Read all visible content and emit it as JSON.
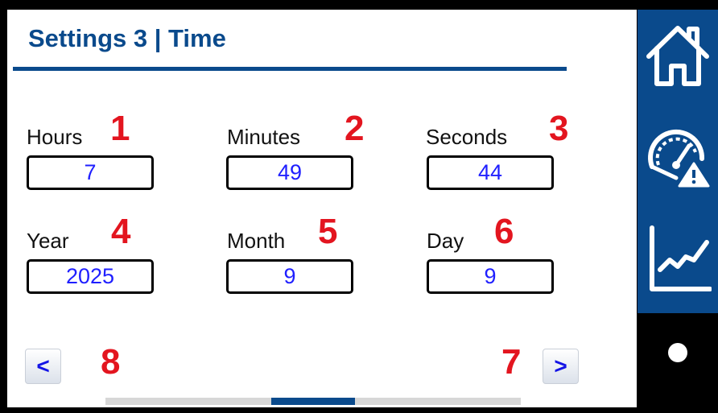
{
  "header": {
    "title": "Settings 3 | Time"
  },
  "fields": [
    {
      "label": "Hours",
      "value": "7",
      "callout": "1"
    },
    {
      "label": "Minutes",
      "value": "49",
      "callout": "2"
    },
    {
      "label": "Seconds",
      "value": "44",
      "callout": "3"
    },
    {
      "label": "Year",
      "value": "2025",
      "callout": "4"
    },
    {
      "label": "Month",
      "value": "9",
      "callout": "5"
    },
    {
      "label": "Day",
      "value": "9",
      "callout": "6"
    }
  ],
  "navigation": {
    "prev": {
      "label": "<",
      "callout": "8"
    },
    "next": {
      "label": ">",
      "callout": "7"
    },
    "progress": {
      "page": 3,
      "page_count": 5
    }
  },
  "sidebar": {
    "icons": [
      "home-icon",
      "gauge-alarm-icon",
      "trend-chart-icon",
      "gear-icon"
    ],
    "active": "gear-icon"
  },
  "colors": {
    "primary": "#0a4a8c",
    "value_text": "#1f1fff",
    "callout": "#e3151f",
    "nav_arrow": "#1414e6"
  }
}
